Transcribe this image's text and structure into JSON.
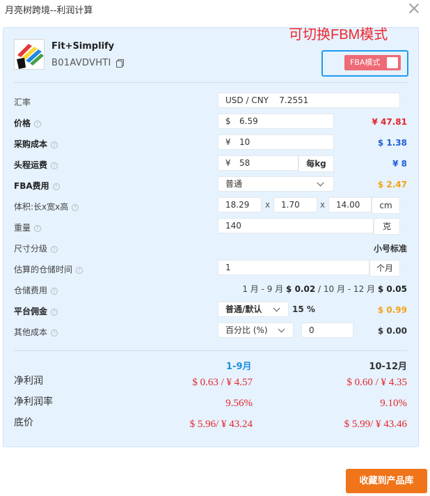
{
  "window": {
    "title": "月亮树跨境--利润计算"
  },
  "annotation": "可切换FBM模式",
  "product": {
    "name": "Fit+Simplify",
    "asin": "B01AVDVHTI"
  },
  "fba_toggle": {
    "label": "FBA模式",
    "checked": false
  },
  "rows": {
    "exchange": {
      "label": "汇率",
      "value": "USD / CNY    7.2551"
    },
    "price": {
      "label": "价格",
      "currency": "$",
      "input": "6.59",
      "result": "¥ 47.81"
    },
    "purchase": {
      "label": "采购成本",
      "currency": "¥",
      "input": "10",
      "result": "$ 1.38"
    },
    "freight": {
      "label": "头程运费",
      "currency": "¥",
      "input": "58",
      "unit": "每kg",
      "result": "¥ 8"
    },
    "fba_fee": {
      "label": "FBA费用",
      "select": "普通",
      "result": "$ 2.47"
    },
    "volume": {
      "label": "体积:长x宽x高",
      "l": "18.29",
      "w": "1.70",
      "h": "14.00",
      "sep": "x",
      "unit": "cm"
    },
    "weight": {
      "label": "重量",
      "input": "140",
      "unit": "克"
    },
    "size_tier": {
      "label": "尺寸分级",
      "value": "小号标准"
    },
    "storage_time": {
      "label": "估算的仓储时间",
      "input": "1",
      "unit": "个月"
    },
    "storage_fee": {
      "label": "仓储费用",
      "p1": "1 月 - 9 月",
      "v1": "$ 0.02",
      "sep": "/",
      "p2": "10 月 - 12 月",
      "v2": "$ 0.05"
    },
    "commission": {
      "label": "平台佣金",
      "select": "普通/默认",
      "percent": "15 %",
      "result": "$ 0.99"
    },
    "other": {
      "label": "其他成本",
      "select": "百分比 (%)",
      "input": "0",
      "result": "$ 0.00"
    }
  },
  "results": {
    "col1": "1-9月",
    "col2": "10-12月",
    "net_profit": {
      "label": "净利润",
      "v1": "$ 0.63 /  ¥ 4.57",
      "v2": "$ 0.60 /  ¥ 4.35"
    },
    "margin": {
      "label": "净利润率",
      "v1": "9.56%",
      "v2": "9.10%"
    },
    "floor": {
      "label": "底价",
      "v1": "$ 5.96/ ¥ 43.24",
      "v2": "$ 5.99/ ¥ 43.46"
    }
  },
  "save_button": "收藏到产品库",
  "colors": {
    "accent_orange": "#f0741a",
    "red": "#e3262e",
    "blue": "#1f5fd6",
    "panel_bg": "#e6f2fd",
    "highlight_box": "#1c9bef"
  }
}
